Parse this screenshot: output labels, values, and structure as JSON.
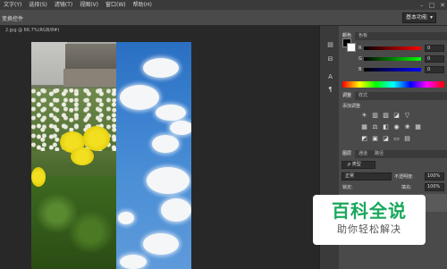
{
  "menubar": {
    "items": [
      "文字(Y)",
      "选择(S)",
      "滤镜(T)",
      "视图(V)",
      "窗口(W)",
      "帮助(H)"
    ],
    "window_controls": [
      "–",
      "□",
      "✕"
    ]
  },
  "options_bar": {
    "label": "变换控件",
    "workspace": "基本功能"
  },
  "document": {
    "tab_title": "2.jpg @ 66.7%(RGB/8#)"
  },
  "panels": {
    "color_tabs": [
      "颜色",
      "色板"
    ],
    "channels": [
      {
        "label": "R",
        "value": "0"
      },
      {
        "label": "G",
        "value": "0"
      },
      {
        "label": "B",
        "value": "0"
      }
    ],
    "adjust_tabs": [
      "调整",
      "样式"
    ],
    "adjust_title": "添加调整",
    "layers_tabs": [
      "图层",
      "通道",
      "路径"
    ],
    "layers_filter": "ρ 类型",
    "blend_mode": "正常",
    "opacity_label": "不透明度:",
    "opacity_value": "100%",
    "lock_label": "锁定:",
    "fill_label": "填充:",
    "fill_value": "100%"
  },
  "watermark": {
    "title": "百科全说",
    "subtitle": "助你轻松解决"
  },
  "colors": {
    "menu_bg": "#3a3a3a",
    "panel_bg": "#4a4a4a",
    "canvas_bg": "#282828",
    "brand_green": "#19a85c"
  }
}
